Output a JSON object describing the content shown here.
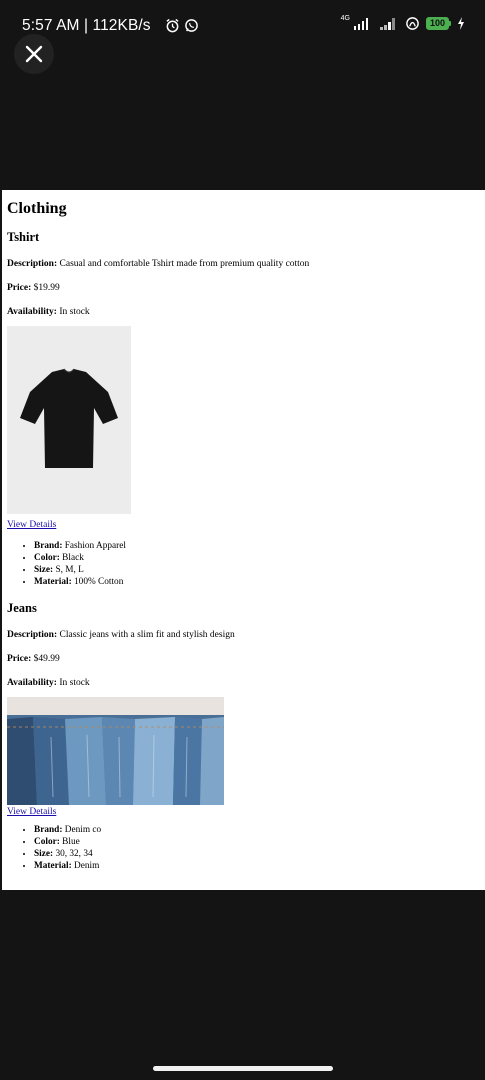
{
  "status_bar": {
    "time_speed": "5:57 AM | 112KB/s",
    "network_tag": "4G",
    "battery": "100"
  },
  "page": {
    "heading": "Clothing",
    "products": [
      {
        "name": "Tshirt",
        "description_label": "Description:",
        "description": "Casual and comfortable Tshirt made from premium quality cotton",
        "price_label": "Price:",
        "price": "$19.99",
        "availability_label": "Availability:",
        "availability": "In stock",
        "link": "View Details",
        "specs": [
          {
            "label": "Brand:",
            "value": "Fashion Apparel"
          },
          {
            "label": "Color:",
            "value": "Black"
          },
          {
            "label": "Size:",
            "value": "S, M, L"
          },
          {
            "label": "Material:",
            "value": "100% Cotton"
          }
        ]
      },
      {
        "name": "Jeans",
        "description_label": "Description:",
        "description": "Classic jeans with a slim fit and stylish design",
        "price_label": "Price:",
        "price": "$49.99",
        "availability_label": "Availability:",
        "availability": "In stock",
        "link": "View Details",
        "specs": [
          {
            "label": "Brand:",
            "value": "Denim co"
          },
          {
            "label": "Color:",
            "value": "Blue"
          },
          {
            "label": "Size:",
            "value": "30, 32, 34"
          },
          {
            "label": "Material:",
            "value": "Denim"
          }
        ]
      }
    ]
  },
  "colors": {
    "background": "#141414",
    "page": "#ffffff",
    "link": "#1a0dab",
    "battery": "#4caf50"
  },
  "icons": [
    "alarm-icon",
    "whatsapp-icon",
    "signal-icon",
    "hotspot-icon",
    "battery-icon",
    "charging-icon",
    "close-icon"
  ]
}
